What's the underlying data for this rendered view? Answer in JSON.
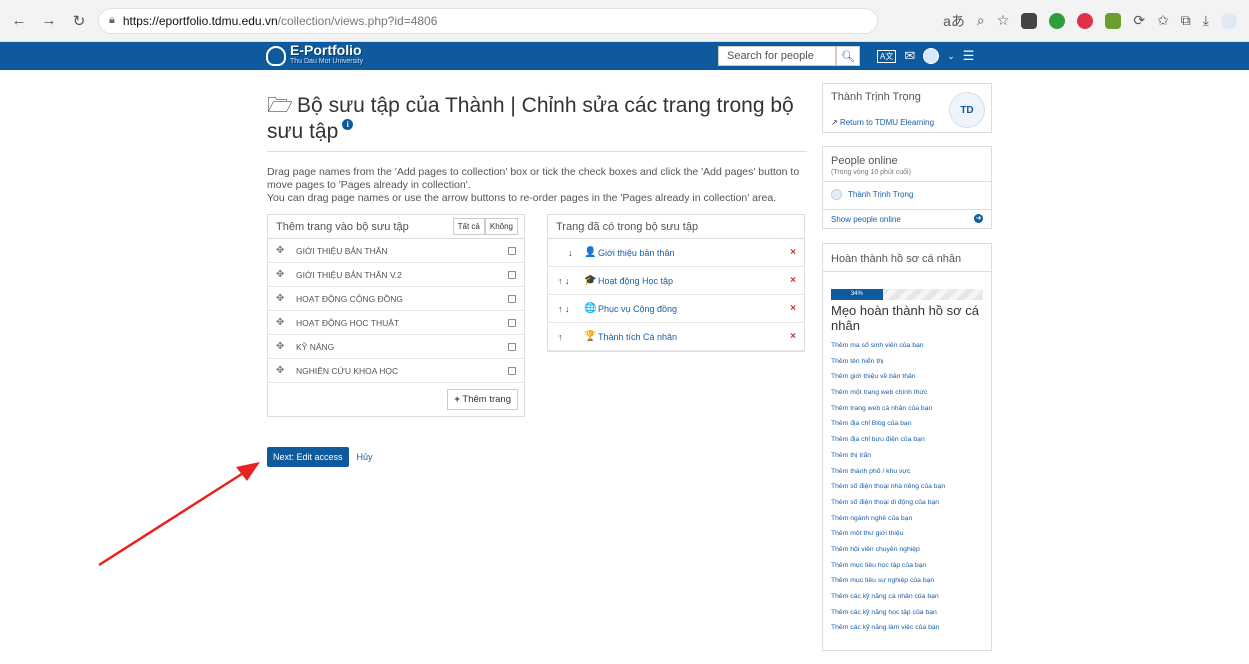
{
  "browser": {
    "url_host": "https://eportfolio.tdmu.edu.vn",
    "url_path": "/collection/views.php?id=4806"
  },
  "header": {
    "logo_title": "E-Portfolio",
    "logo_subtitle": "Thu Dau Mot University",
    "search_placeholder": "Search for people"
  },
  "main": {
    "title": "Bộ sưu tập của Thành | Chỉnh sửa các trang trong bộ sưu tập",
    "intro_line1": "Drag page names from the 'Add pages to collection' box or tick the check boxes and click the 'Add pages' button to move pages to 'Pages already in collection'.",
    "intro_line2": "You can drag page names or use the arrow buttons to re-order pages in the 'Pages already in collection' area.",
    "add_panel": {
      "title": "Thêm trang vào bộ sưu tập",
      "select_all": "Tất cả",
      "select_none": "Không",
      "items": [
        "GIỚI THIỆU BẢN THÂN",
        "GIỚI THIỆU BẢN THÂN v.2",
        "HOẠT ĐỘNG CỘNG ĐỒNG",
        "HOẠT ĐỘNG HỌC THUẬT",
        "KỸ NĂNG",
        "NGHIÊN CỨU KHOA HỌC"
      ],
      "add_button": "Thêm trang"
    },
    "in_panel": {
      "title": "Trang đã có trong bộ sưu tập",
      "items": [
        {
          "arrows": "↓",
          "label": "Giới thiệu bản thân"
        },
        {
          "arrows": "↑ ↓",
          "label": "Hoạt động Học tập"
        },
        {
          "arrows": "↑ ↓",
          "label": "Phục vụ Cộng đồng"
        },
        {
          "arrows": "↑",
          "label": "Thành tích Cá nhân"
        }
      ]
    },
    "next_button": "Next: Edit access",
    "cancel_link": "Hủy"
  },
  "sidebar": {
    "user_name": "Thành Trịnh Trọng",
    "return_link": "Return to TDMU Elearning",
    "people_online_title": "People online",
    "people_online_sub": "(Trong vòng 10 phút cuối)",
    "online_user": "Thành Trịnh Trọng",
    "show_people": "Show people online",
    "profile_title": "Hoàn thành hồ sơ cá nhân",
    "progress_percent": 34,
    "progress_label": "34%",
    "tips_title": "Mẹo hoàn thành hồ sơ cá nhân",
    "tips": [
      "Thêm ma số sinh viên của bạn",
      "Thêm tên hiển thị",
      "Thêm giới thiệu về bản thân",
      "Thêm một trang web chính thức",
      "Thêm trang web cá nhân của bạn",
      "Thêm địa chỉ Blog của bạn",
      "Thêm địa chỉ bưu điện của bạn",
      "Thêm thị trấn",
      "Thêm thành phố / khu vực",
      "Thêm số điện thoại nhà riêng của bạn",
      "Thêm số điện thoại di động của bạn",
      "Thêm ngành nghề của bạn",
      "Thêm một thư giới thiệu",
      "Thêm hội viên chuyên nghiệp",
      "Thêm mục tiêu học tập của bạn",
      "Thêm mục tiêu sự nghiệp của bạn",
      "Thêm các kỹ năng cá nhân của bạn",
      "Thêm các kỹ năng học tập của bạn",
      "Thêm các kỹ năng làm việc của bạn"
    ]
  },
  "colors": {
    "brand": "#0f5a9c",
    "link": "#1a5fa8",
    "annotation_arrow": "#e8231f"
  }
}
